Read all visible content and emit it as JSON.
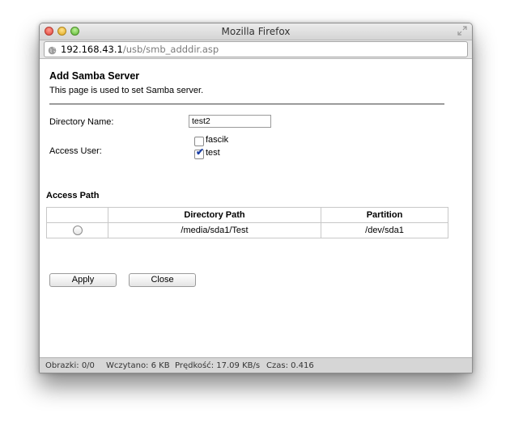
{
  "window": {
    "title": "Mozilla Firefox"
  },
  "address": {
    "host": "192.168.43.1",
    "path": "/usb/smb_adddir.asp"
  },
  "page": {
    "heading": "Add Samba Server",
    "description": "This page is used to set Samba server.",
    "directory_label": "Directory Name:",
    "directory_value": "test2",
    "access_user_label": "Access User:",
    "users": [
      {
        "name": "fascik",
        "checked": false
      },
      {
        "name": "test",
        "checked": true
      }
    ],
    "access_path_heading": "Access Path",
    "table": {
      "headers": [
        "",
        "Directory Path",
        "Partition"
      ],
      "rows": [
        {
          "path": "/media/sda1/Test",
          "partition": "/dev/sda1"
        }
      ]
    },
    "apply_label": "Apply",
    "close_label": "Close"
  },
  "status": {
    "images": "Obrazki: 0/0",
    "loaded": "Wczytano: 6 KB",
    "speed": "Prędkość: 17.09 KB/s",
    "time": "Czas: 0.416"
  }
}
